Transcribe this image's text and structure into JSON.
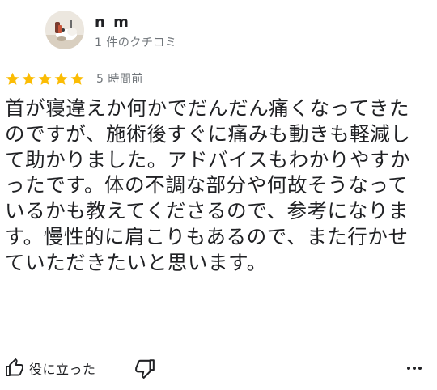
{
  "author": {
    "name": "n m",
    "meta": "1 件のクチコミ"
  },
  "rating": {
    "stars": 5,
    "max": 5,
    "star_color": "#fbbc04",
    "time": "5 時間前"
  },
  "review": {
    "text": "首が寝違えか何かでだんだん痛くなってきたのですが、施術後すぐに痛みも動きも軽減して助かりました。アドバイスもわかりやすかったです。体の不調な部分や何故そうなっているかも教えてくださるので、参考になります。慢性的に肩こりもあるので、また行かせていただきたいと思います。"
  },
  "actions": {
    "helpful_label": "役に立った",
    "thumbs_up_icon": "thumbs-up-icon",
    "thumbs_down_icon": "thumbs-down-icon",
    "more_icon": "more-horizontal-icon"
  }
}
